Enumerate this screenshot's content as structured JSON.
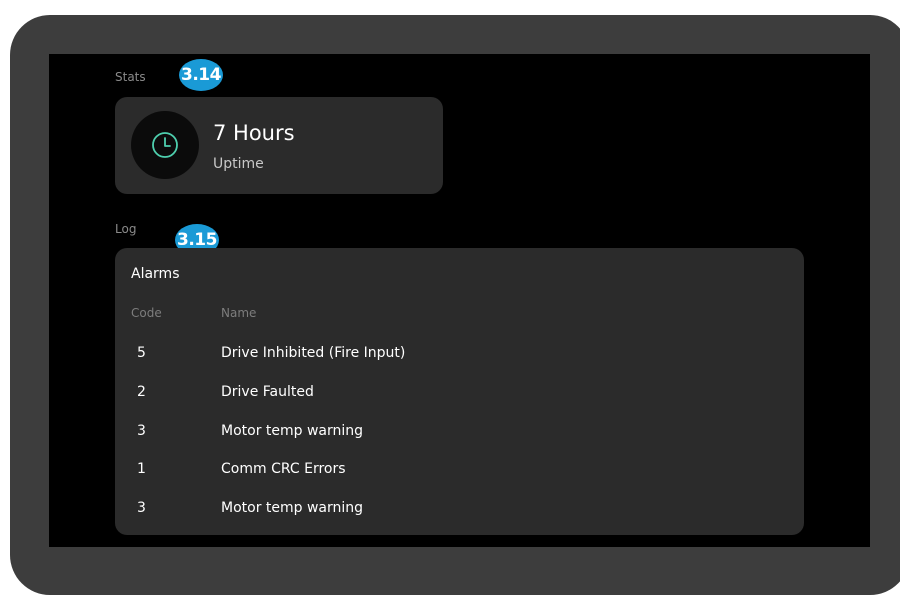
{
  "stats": {
    "section_label": "Stats",
    "badge": "3.14",
    "uptime_value": "7 Hours",
    "uptime_label": "Uptime",
    "icon": "clock-icon",
    "icon_color": "#4ecfae"
  },
  "log": {
    "section_label": "Log",
    "badge": "3.15",
    "card_title": "Alarms",
    "columns": [
      "Code",
      "Name"
    ],
    "rows": [
      {
        "code": "5",
        "name": "Drive Inhibited (Fire Input)"
      },
      {
        "code": "2",
        "name": "Drive Faulted"
      },
      {
        "code": "3",
        "name": "Motor temp warning"
      },
      {
        "code": "1",
        "name": "Comm CRC Errors"
      },
      {
        "code": "3",
        "name": "Motor temp warning"
      }
    ]
  },
  "colors": {
    "badge": "#1a9ad6",
    "card": "#2b2b2b",
    "screen": "#000000",
    "bezel": "#3d3d3d"
  }
}
